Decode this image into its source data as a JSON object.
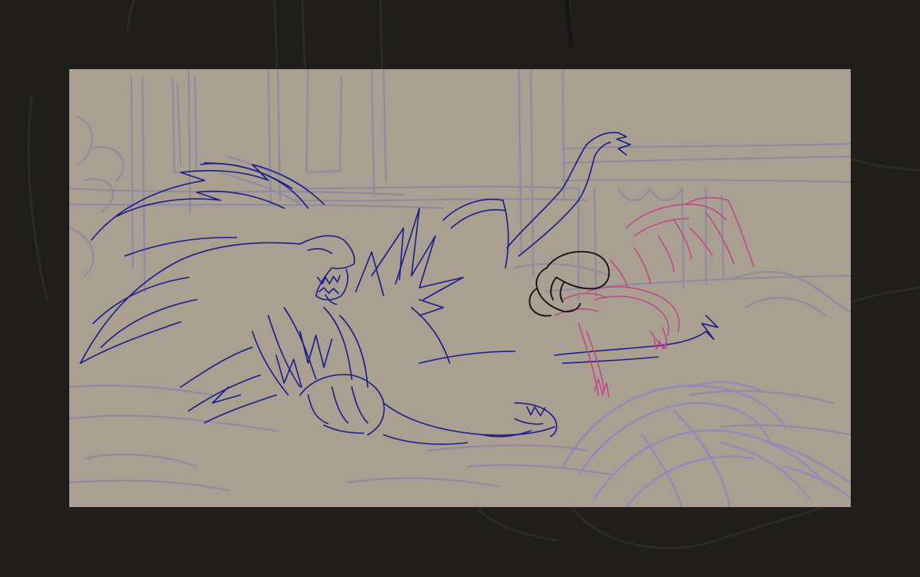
{
  "app": {
    "workspace_bg": "#1f1e1c",
    "canvas_bg": "#a9a092"
  },
  "layers": [
    {
      "name": "background-rough-sketch",
      "color": "#8a84a6",
      "visible": true
    },
    {
      "name": "large-creature-lineart",
      "color": "#1a1f8c",
      "visible": true
    },
    {
      "name": "small-creature-rough",
      "color": "#c4408a",
      "visible": true
    },
    {
      "name": "head-outline",
      "color": "#111111",
      "visible": true
    },
    {
      "name": "foreground-rough",
      "color": "#8c86c8",
      "visible": true
    }
  ]
}
